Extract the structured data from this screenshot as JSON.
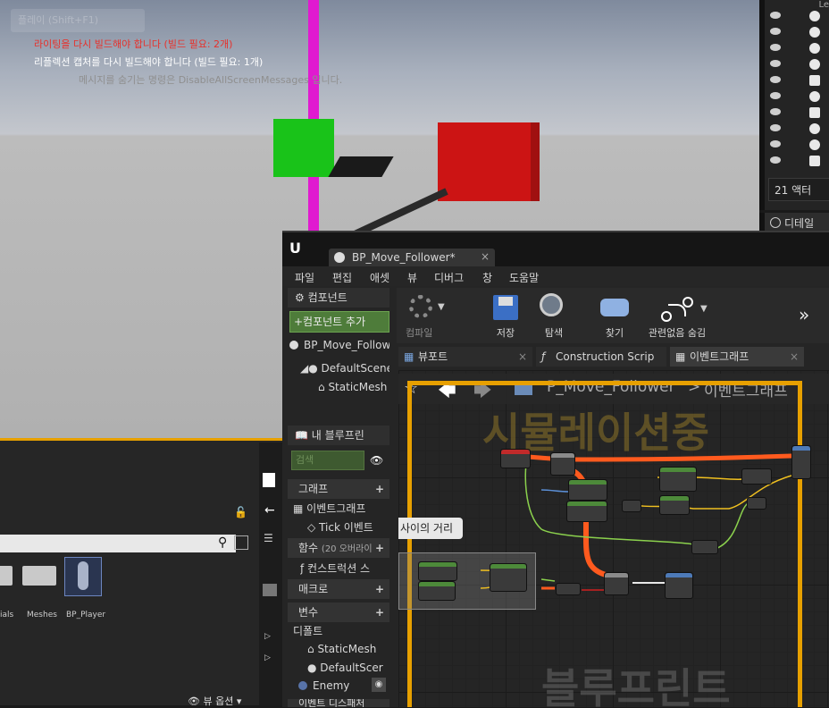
{
  "viewport": {
    "messages": [
      {
        "text": "라이팅을 다시 빌드해야 합니다 (빌드 필요: 2개)",
        "color": "#e8302a"
      },
      {
        "text": "리플렉션 캡처를 다시 빌드해야 합니다 (빌드 필요: 1개)",
        "color": "#ffffff"
      },
      {
        "text": "메시지를 숨기는 명령은 DisableAllScreenMessages 입니다.",
        "color": "#8f8f8f"
      }
    ],
    "ghost_button": "플레이 (Shift+F1)"
  },
  "outliner": {
    "header": "Le",
    "actor_count": "21 액터",
    "details_tab": "디테일"
  },
  "content_browser": {
    "search_placeholder": "",
    "items": [
      {
        "label": "ials"
      },
      {
        "label": "Meshes"
      },
      {
        "label": "BP_Player"
      }
    ],
    "view_options": "뷰 옵션"
  },
  "bp_editor": {
    "tab_title": "BP_Move_Follower*",
    "menu": [
      "파일",
      "편집",
      "애셋",
      "뷰",
      "디버그",
      "창",
      "도움말"
    ],
    "components": {
      "header": "컴포넌트",
      "add_button": "+컴포넌트 추가",
      "root": "BP_Move_Follow",
      "children": [
        "DefaultScene",
        "StaticMesh"
      ]
    },
    "toolbar": [
      {
        "label": "컴파일"
      },
      {
        "label": "저장"
      },
      {
        "label": "탐색"
      },
      {
        "label": "찾기"
      },
      {
        "label": "관련없음 숨김"
      }
    ],
    "graph_tabs": [
      "뷰포트",
      "Construction Scrip",
      "이벤트그래프"
    ],
    "breadcrumb": {
      "root": "P_Move_Follower",
      "sep": ">",
      "current": "이벤트그래프"
    },
    "watermark_top": "시뮬레이션중",
    "watermark_bottom": "블루프린트",
    "comment_label": "사이의 거리",
    "my_blueprint": {
      "header": "내 블루프린",
      "search_placeholder": "검색",
      "sections": [
        {
          "label": "그래프"
        },
        {
          "label": "이벤트그래프"
        },
        {
          "label": "Tick 이벤트"
        },
        {
          "label": "함수",
          "note": "(20 오버라이"
        },
        {
          "label": "컨스트럭션 스"
        },
        {
          "label": "매크로"
        },
        {
          "label": "변수"
        },
        {
          "label": "디폴트"
        },
        {
          "label": "StaticMesh"
        },
        {
          "label": "DefaultScer"
        },
        {
          "label": "Enemy"
        },
        {
          "label": "이벤트 디스패처"
        }
      ]
    }
  },
  "colors": {
    "accent_orange": "#e7a000",
    "exec_wire": "#ff5a1e",
    "vector_wire": "#f0c020",
    "green_wire": "#8bd14d",
    "magenta_pole": "#e01ad0"
  }
}
